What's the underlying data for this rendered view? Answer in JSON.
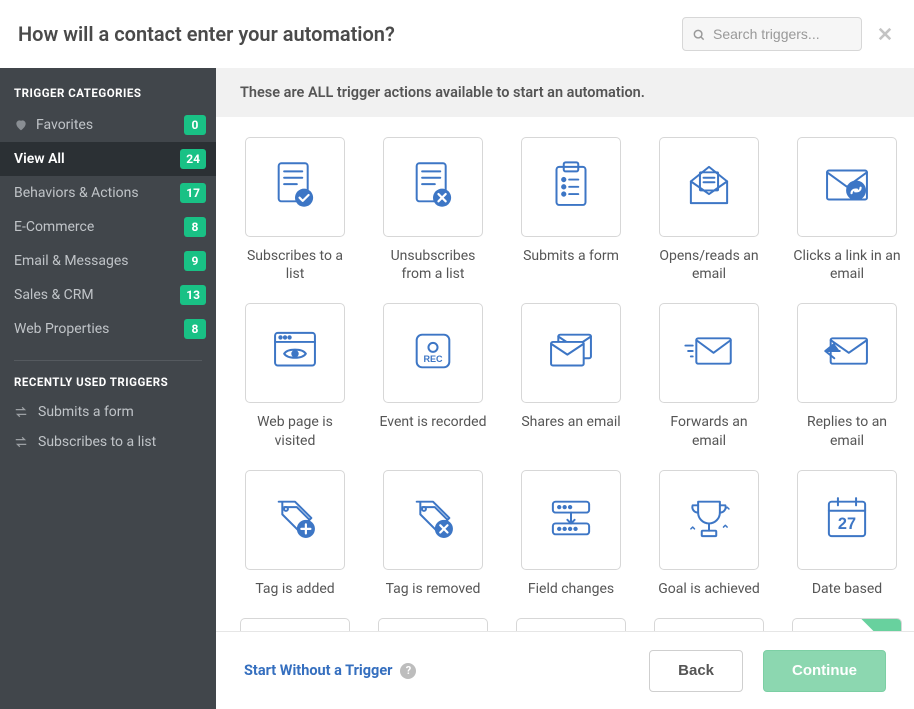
{
  "header": {
    "title": "How will a contact enter your automation?",
    "search_placeholder": "Search triggers..."
  },
  "sidebar": {
    "categories_heading": "TRIGGER CATEGORIES",
    "recent_heading": "RECENTLY USED TRIGGERS",
    "items": [
      {
        "label": "Favorites",
        "count": "0",
        "icon": "heart"
      },
      {
        "label": "View All",
        "count": "24",
        "active": true
      },
      {
        "label": "Behaviors & Actions",
        "count": "17"
      },
      {
        "label": "E-Commerce",
        "count": "8"
      },
      {
        "label": "Email & Messages",
        "count": "9"
      },
      {
        "label": "Sales & CRM",
        "count": "13"
      },
      {
        "label": "Web Properties",
        "count": "8"
      }
    ],
    "recent": [
      {
        "label": "Submits a form"
      },
      {
        "label": "Subscribes to a list"
      }
    ]
  },
  "main": {
    "info": "These are ALL trigger actions available to start an automation.",
    "triggers": [
      {
        "label": "Subscribes to a list"
      },
      {
        "label": "Unsubscribes from a list"
      },
      {
        "label": "Submits a form"
      },
      {
        "label": "Opens/reads an email"
      },
      {
        "label": "Clicks a link in an email"
      },
      {
        "label": "Web page is visited"
      },
      {
        "label": "Event is recorded"
      },
      {
        "label": "Shares an email"
      },
      {
        "label": "Forwards an email"
      },
      {
        "label": "Replies to an email"
      },
      {
        "label": "Tag is added"
      },
      {
        "label": "Tag is removed"
      },
      {
        "label": "Field changes"
      },
      {
        "label": "Goal is achieved"
      },
      {
        "label": "Date based"
      }
    ]
  },
  "footer": {
    "start_without": "Start Without a Trigger",
    "help": "?",
    "back": "Back",
    "continue": "Continue"
  }
}
